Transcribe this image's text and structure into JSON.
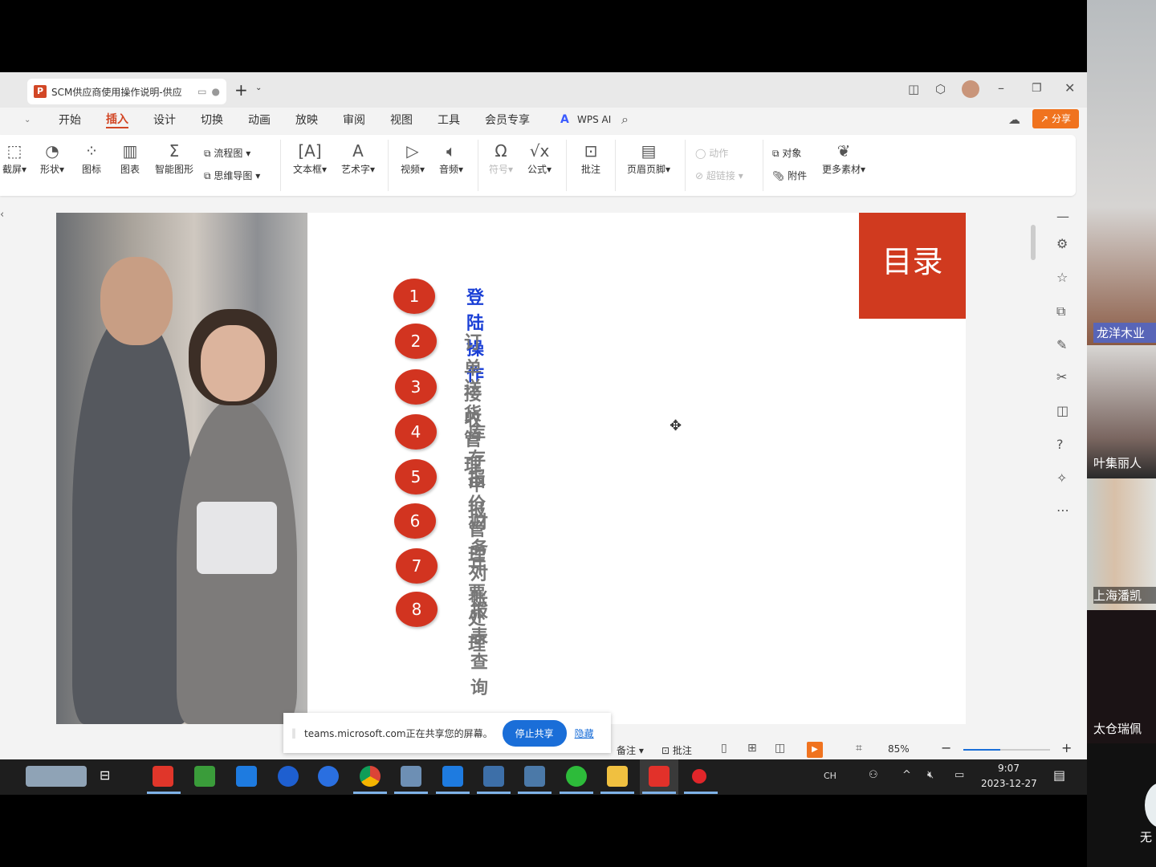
{
  "window": {
    "doc_tab": "SCM供应商使用操作说明-供应",
    "new_tab": "+"
  },
  "menu": [
    "开始",
    "插入",
    "设计",
    "切换",
    "动画",
    "放映",
    "审阅",
    "视图",
    "工具",
    "会员专享"
  ],
  "menu_active": "插入",
  "wps_ai": "WPS AI",
  "share_button": "分享",
  "ribbon": {
    "screenshot": "截屏",
    "shape": "形状",
    "icons": "图标",
    "chart": "图表",
    "smartart": "智能图形",
    "flowchart": "流程图",
    "mindmap": "思维导图",
    "textbox": "文本框",
    "wordart": "艺术字",
    "video": "视频",
    "audio": "音频",
    "symbol": "符号",
    "formula": "公式",
    "comment": "批注",
    "header_footer": "页眉页脚",
    "action": "动作",
    "hyperlink": "超链接",
    "object": "对象",
    "attachment": "附件",
    "more_materials": "更多素材"
  },
  "slide": {
    "title": "目录",
    "items": [
      {
        "num": "1",
        "label": "登陆操作",
        "highlight": true
      },
      {
        "num": "2",
        "label": "订单接收"
      },
      {
        "num": "3",
        "label": "送货管理"
      },
      {
        "num": "4",
        "label": "库存申报"
      },
      {
        "num": "5",
        "label": "报价管理"
      },
      {
        "num": "6",
        "label": "财务对账"
      },
      {
        "num": "7",
        "label": "开票处理"
      },
      {
        "num": "8",
        "label": "报表查询"
      }
    ]
  },
  "status": {
    "notes": "备注",
    "comment": "批注",
    "zoom": "85%",
    "zoom_level_percent": 85
  },
  "screen_share": {
    "message": "teams.microsoft.com正在共享您的屏幕。",
    "stop": "停止共享",
    "hide": "隐藏"
  },
  "taskbar": {
    "ime": "CH",
    "time": "9:07",
    "date": "2023-12-27"
  },
  "participants": [
    "龙洋木业",
    "叶集丽人",
    "上海潘凯",
    "太仓瑞佩",
    "无"
  ],
  "colors": {
    "accent": "#d24726",
    "slide_red": "#d03a1f",
    "highlight_blue": "#1a3fd6",
    "teams_blue": "#1a6ed8"
  }
}
